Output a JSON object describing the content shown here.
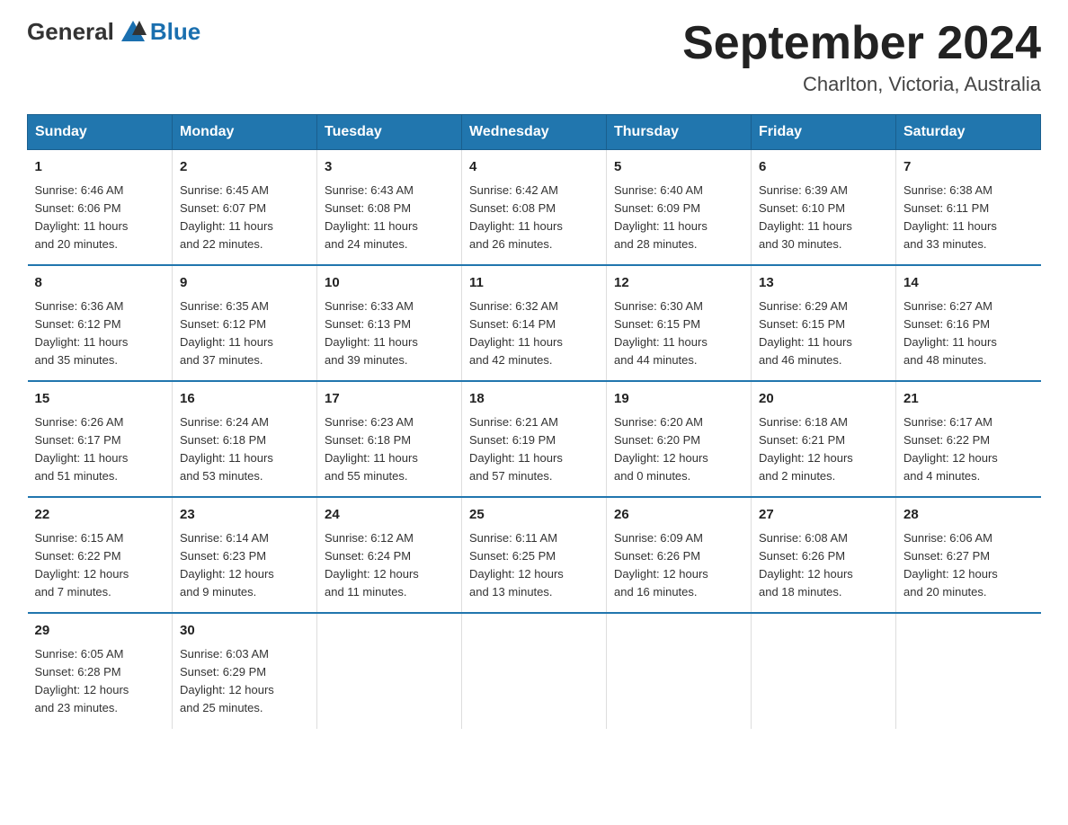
{
  "header": {
    "logo_general": "General",
    "logo_blue": "Blue",
    "title": "September 2024",
    "subtitle": "Charlton, Victoria, Australia"
  },
  "days_of_week": [
    "Sunday",
    "Monday",
    "Tuesday",
    "Wednesday",
    "Thursday",
    "Friday",
    "Saturday"
  ],
  "weeks": [
    [
      {
        "day": "1",
        "sunrise": "6:46 AM",
        "sunset": "6:06 PM",
        "daylight": "11 hours and 20 minutes."
      },
      {
        "day": "2",
        "sunrise": "6:45 AM",
        "sunset": "6:07 PM",
        "daylight": "11 hours and 22 minutes."
      },
      {
        "day": "3",
        "sunrise": "6:43 AM",
        "sunset": "6:08 PM",
        "daylight": "11 hours and 24 minutes."
      },
      {
        "day": "4",
        "sunrise": "6:42 AM",
        "sunset": "6:08 PM",
        "daylight": "11 hours and 26 minutes."
      },
      {
        "day": "5",
        "sunrise": "6:40 AM",
        "sunset": "6:09 PM",
        "daylight": "11 hours and 28 minutes."
      },
      {
        "day": "6",
        "sunrise": "6:39 AM",
        "sunset": "6:10 PM",
        "daylight": "11 hours and 30 minutes."
      },
      {
        "day": "7",
        "sunrise": "6:38 AM",
        "sunset": "6:11 PM",
        "daylight": "11 hours and 33 minutes."
      }
    ],
    [
      {
        "day": "8",
        "sunrise": "6:36 AM",
        "sunset": "6:12 PM",
        "daylight": "11 hours and 35 minutes."
      },
      {
        "day": "9",
        "sunrise": "6:35 AM",
        "sunset": "6:12 PM",
        "daylight": "11 hours and 37 minutes."
      },
      {
        "day": "10",
        "sunrise": "6:33 AM",
        "sunset": "6:13 PM",
        "daylight": "11 hours and 39 minutes."
      },
      {
        "day": "11",
        "sunrise": "6:32 AM",
        "sunset": "6:14 PM",
        "daylight": "11 hours and 42 minutes."
      },
      {
        "day": "12",
        "sunrise": "6:30 AM",
        "sunset": "6:15 PM",
        "daylight": "11 hours and 44 minutes."
      },
      {
        "day": "13",
        "sunrise": "6:29 AM",
        "sunset": "6:15 PM",
        "daylight": "11 hours and 46 minutes."
      },
      {
        "day": "14",
        "sunrise": "6:27 AM",
        "sunset": "6:16 PM",
        "daylight": "11 hours and 48 minutes."
      }
    ],
    [
      {
        "day": "15",
        "sunrise": "6:26 AM",
        "sunset": "6:17 PM",
        "daylight": "11 hours and 51 minutes."
      },
      {
        "day": "16",
        "sunrise": "6:24 AM",
        "sunset": "6:18 PM",
        "daylight": "11 hours and 53 minutes."
      },
      {
        "day": "17",
        "sunrise": "6:23 AM",
        "sunset": "6:18 PM",
        "daylight": "11 hours and 55 minutes."
      },
      {
        "day": "18",
        "sunrise": "6:21 AM",
        "sunset": "6:19 PM",
        "daylight": "11 hours and 57 minutes."
      },
      {
        "day": "19",
        "sunrise": "6:20 AM",
        "sunset": "6:20 PM",
        "daylight": "12 hours and 0 minutes."
      },
      {
        "day": "20",
        "sunrise": "6:18 AM",
        "sunset": "6:21 PM",
        "daylight": "12 hours and 2 minutes."
      },
      {
        "day": "21",
        "sunrise": "6:17 AM",
        "sunset": "6:22 PM",
        "daylight": "12 hours and 4 minutes."
      }
    ],
    [
      {
        "day": "22",
        "sunrise": "6:15 AM",
        "sunset": "6:22 PM",
        "daylight": "12 hours and 7 minutes."
      },
      {
        "day": "23",
        "sunrise": "6:14 AM",
        "sunset": "6:23 PM",
        "daylight": "12 hours and 9 minutes."
      },
      {
        "day": "24",
        "sunrise": "6:12 AM",
        "sunset": "6:24 PM",
        "daylight": "12 hours and 11 minutes."
      },
      {
        "day": "25",
        "sunrise": "6:11 AM",
        "sunset": "6:25 PM",
        "daylight": "12 hours and 13 minutes."
      },
      {
        "day": "26",
        "sunrise": "6:09 AM",
        "sunset": "6:26 PM",
        "daylight": "12 hours and 16 minutes."
      },
      {
        "day": "27",
        "sunrise": "6:08 AM",
        "sunset": "6:26 PM",
        "daylight": "12 hours and 18 minutes."
      },
      {
        "day": "28",
        "sunrise": "6:06 AM",
        "sunset": "6:27 PM",
        "daylight": "12 hours and 20 minutes."
      }
    ],
    [
      {
        "day": "29",
        "sunrise": "6:05 AM",
        "sunset": "6:28 PM",
        "daylight": "12 hours and 23 minutes."
      },
      {
        "day": "30",
        "sunrise": "6:03 AM",
        "sunset": "6:29 PM",
        "daylight": "12 hours and 25 minutes."
      },
      null,
      null,
      null,
      null,
      null
    ]
  ],
  "labels": {
    "sunrise": "Sunrise:",
    "sunset": "Sunset:",
    "daylight": "Daylight:"
  }
}
